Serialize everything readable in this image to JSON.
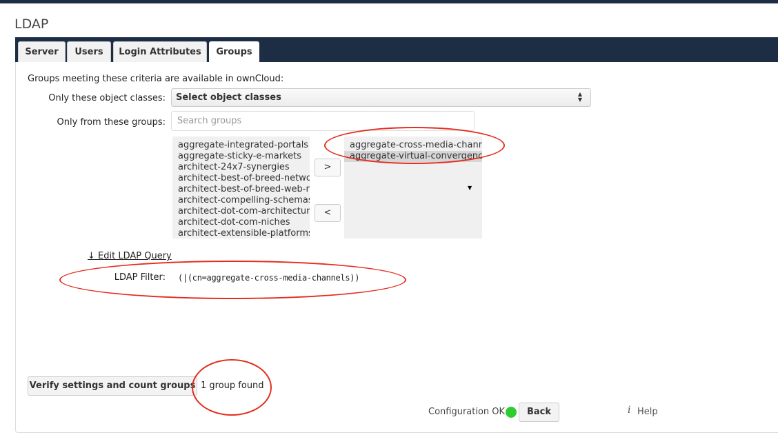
{
  "page": {
    "title": "LDAP"
  },
  "tabs": [
    {
      "label": "Server"
    },
    {
      "label": "Users"
    },
    {
      "label": "Login Attributes"
    },
    {
      "label": "Groups"
    }
  ],
  "groups": {
    "intro": "Groups meeting these criteria are available in ownCloud:",
    "object_classes": {
      "label": "Only these object classes:",
      "value": "Select object classes"
    },
    "from_groups": {
      "label": "Only from these groups:",
      "placeholder": "Search groups"
    },
    "available": [
      "aggregate-integrated-portals",
      "aggregate-sticky-e-markets",
      "architect-24x7-synergies",
      "architect-best-of-breed-netwo",
      "architect-best-of-breed-web-r",
      "architect-compelling-schemas",
      "architect-dot-com-architectur",
      "architect-dot-com-niches",
      "architect-extensible-platforms"
    ],
    "selected": [
      "aggregate-cross-media-chann",
      "aggregate-virtual-convergenc"
    ],
    "add_button": ">",
    "remove_button": "<",
    "edit_query_link": "↓ Edit LDAP Query",
    "filter": {
      "label": "LDAP Filter:",
      "value": "(|(cn=aggregate-cross-media-channels))"
    },
    "verify_button": "Verify settings and count groups",
    "result": "1 group found"
  },
  "footer": {
    "status": "Configuration OK",
    "status_color": "#2fcc2f",
    "back_button": "Back",
    "help_icon": "i",
    "help_label": "Help"
  },
  "annotation_color": "#e32d1f"
}
